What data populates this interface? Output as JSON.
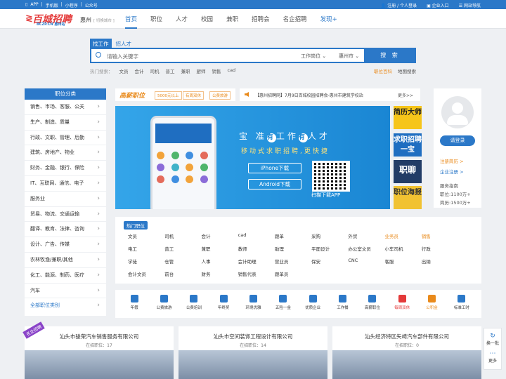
{
  "topbar": {
    "left": [
      "APP",
      "手机版",
      "小程序",
      "公众号"
    ],
    "right": [
      "注册 / 个人登录",
      "企业入口",
      "网站导航"
    ]
  },
  "logo": {
    "mark": "≷",
    "title": "百城招聘",
    "sub": "BCZP.CN 惠州站"
  },
  "city": {
    "name": "惠州",
    "switch": "[ 切换城市 ]"
  },
  "nav": [
    "首页",
    "职位",
    "人才",
    "校园",
    "兼职",
    "招聘会",
    "名企招聘",
    "发现+"
  ],
  "search": {
    "tabs": [
      "找工作",
      "招人才"
    ],
    "placeholder": "请输入关键字",
    "type": "工作岗位 ⌄",
    "area": "惠州市 ⌄",
    "button": "搜 索",
    "hot_label": "热门搜索：",
    "hot": [
      "文员",
      "会计",
      "司机",
      "普工",
      "兼职",
      "厨师",
      "销售",
      "cad"
    ],
    "links": [
      "职位百科",
      "地图搜索"
    ]
  },
  "categories": {
    "title": "职位分类",
    "items": [
      "销售、市场、客服、公关",
      "生产、制造、质量",
      "行政、文职、管理、后勤",
      "建筑、房地产、物业",
      "财务、金融、银行、保险",
      "IT、互联网、通信、电子",
      "服务业",
      "贸易、物流、交通运输",
      "翻译、教育、法律、咨询",
      "设计、广告、传媒",
      "农林牧渔/兼职/其他",
      "化工、能源、制药、医疗",
      "汽车"
    ],
    "all": "全部职位类别"
  },
  "promo": {
    "title": "高薪职位",
    "tags": [
      "5000元以上",
      "有周双休",
      "公费旅游"
    ]
  },
  "notice": {
    "text": "【惠州招聘网】7月9日百城校园招聘会-惠州市建筑学校站",
    "more": "更多>>"
  },
  "banner": {
    "slogan_a": "宝",
    "slogan_chars": [
      "准",
      "有",
      "工作",
      "有",
      "人才"
    ],
    "sub": "移动式求职招聘,更快捷",
    "ios": "iPhone下载",
    "android": "Android下载",
    "qr": "扫描下载APP"
  },
  "side_ads": [
    {
      "text": "简历大师",
      "bg": "#f6c51a",
      "fg": "#222"
    },
    {
      "text": "求职招聘一宝",
      "bg": "#1f6ec1",
      "fg": "#fff"
    },
    {
      "text": "职聊",
      "bg": "#223c66",
      "fg": "#fff"
    },
    {
      "text": "职位海报",
      "bg": "#f1c232",
      "fg": "#333"
    }
  ],
  "user": {
    "login": "请登录",
    "reg_resume": "注册简历 >",
    "reg_company": "企业注册 >",
    "service": "服务指南",
    "jobs": "职位:1100万+",
    "resumes": "简历:1500万+"
  },
  "hotjobs": {
    "title": "热门职位",
    "items": [
      "文员",
      "司机",
      "会计",
      "cad",
      "跟单",
      "采购",
      "外贸",
      "业务员",
      "销售",
      "电工",
      "普工",
      "兼职",
      "教师",
      "助理",
      "平面设计",
      "办公室文员",
      "小车司机",
      "行政",
      "学徒",
      "仓管",
      "人事",
      "会计助理",
      "营业员",
      "保安",
      "CNC",
      "客服",
      "出纳",
      "会计文员",
      "前台",
      "财务",
      "销售代表",
      "跟单员"
    ],
    "orange": [
      "业务员",
      "销售"
    ]
  },
  "welfare": [
    {
      "label": "年假",
      "color": "#2b78c8"
    },
    {
      "label": "公费旅游",
      "color": "#2b78c8"
    },
    {
      "label": "公费培训",
      "color": "#2b78c8"
    },
    {
      "label": "年终奖",
      "color": "#2b78c8"
    },
    {
      "label": "环境优雅",
      "color": "#2b78c8"
    },
    {
      "label": "五险一金",
      "color": "#2b78c8"
    },
    {
      "label": "优质企业",
      "color": "#2b78c8"
    },
    {
      "label": "工作餐",
      "color": "#2b78c8"
    },
    {
      "label": "高薪职位",
      "color": "#2b78c8"
    },
    {
      "label": "每周双休",
      "color": "#e43a3a"
    },
    {
      "label": "公积金",
      "color": "#e98a1b"
    },
    {
      "label": "标准工时",
      "color": "#2b78c8"
    }
  ],
  "companies": [
    {
      "name": "汕头市骏荣汽车销售服务有限公司",
      "count": "在招职位：17",
      "ribbon": "名企招聘"
    },
    {
      "name": "汕头市空间装饰工程设计有限公司",
      "count": "在招职位：14",
      "ribbon": ""
    },
    {
      "name": "汕头经济特区矢崎汽车部件有限公司",
      "count": "在招职位：0",
      "ribbon": ""
    }
  ],
  "float": {
    "switch": "换一批",
    "more": "更多"
  }
}
